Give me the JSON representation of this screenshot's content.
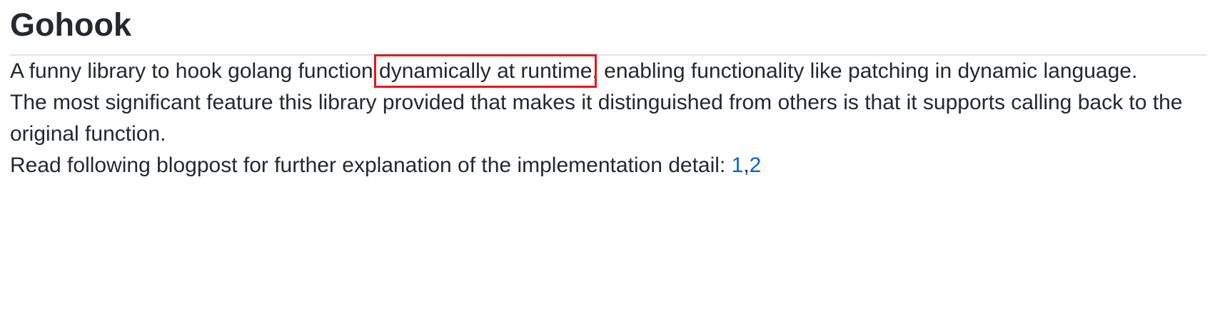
{
  "readme": {
    "title": "Gohook",
    "paragraph1": {
      "before": "A funny library to hook golang function ",
      "highlight": "dynamically at runtime",
      "after": ", enabling functionality like patching in dynamic language."
    },
    "paragraph2": "The most significant feature this library provided that makes it distinguished from others is that it supports calling back to the original function.",
    "paragraph3": {
      "text": "Read following blogpost for further explanation of the implementation detail: ",
      "link1": "1",
      "separator": ",",
      "link2": "2"
    }
  },
  "colors": {
    "text": "#24292e",
    "link": "#0366d6",
    "highlight_box": "#e8141c",
    "divider": "#e1e4e8"
  }
}
